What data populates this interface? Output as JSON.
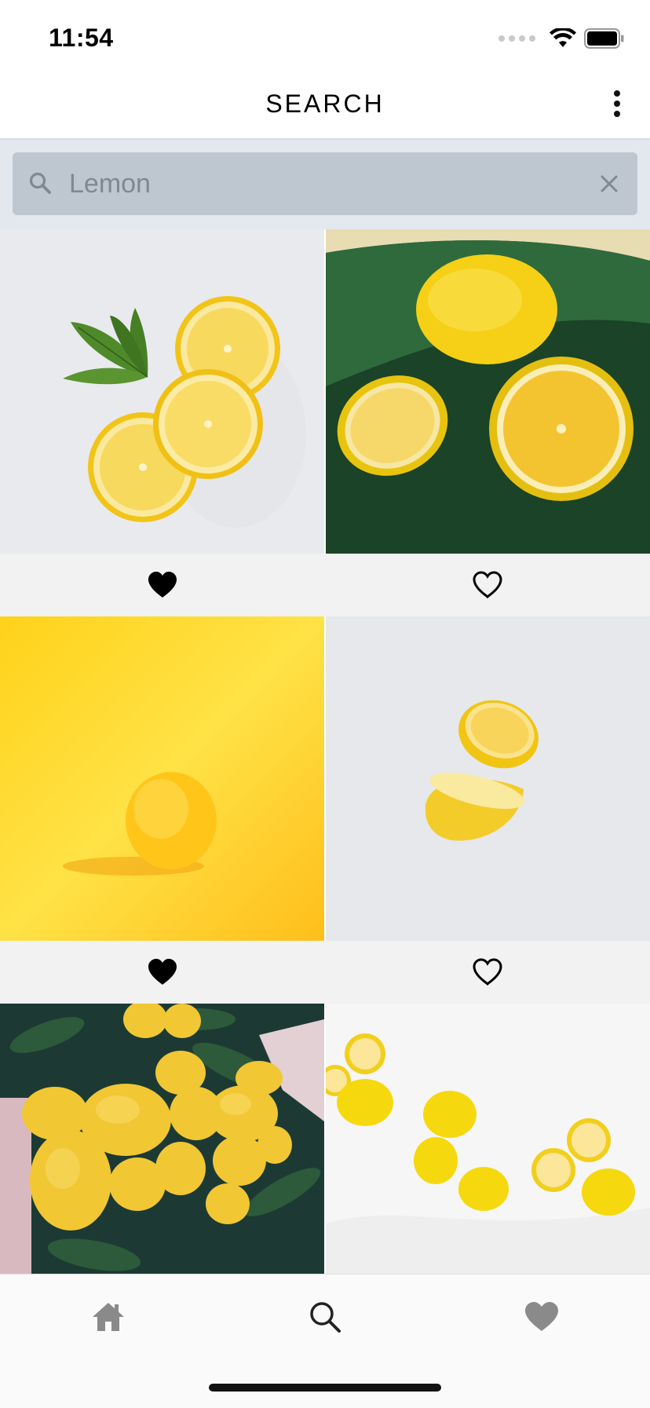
{
  "status_bar": {
    "time": "11:54",
    "icons": [
      "cellular-signal-icon",
      "wifi-icon",
      "battery-icon"
    ]
  },
  "header": {
    "title": "SEARCH",
    "menu_icon": "more-vertical-icon"
  },
  "search": {
    "value": "Lemon",
    "search_icon": "search-icon",
    "clear_icon": "close-icon"
  },
  "results": [
    {
      "image": "lemon-slices-with-leaves-photo",
      "liked": true
    },
    {
      "image": "cut-lemons-on-green-leaf-photo",
      "liked": false
    },
    {
      "image": "single-lemon-on-yellow-photo",
      "liked": true
    },
    {
      "image": "floating-lemon-halves-photo",
      "liked": false
    },
    {
      "image": "lemon-tree-photo",
      "liked": null
    },
    {
      "image": "lemons-on-white-cloth-photo",
      "liked": null
    }
  ],
  "tab_bar": {
    "tabs": [
      {
        "icon": "home-icon",
        "active": false
      },
      {
        "icon": "search-icon",
        "active": true
      },
      {
        "icon": "heart-icon",
        "active": false
      }
    ]
  },
  "colors": {
    "search_bg": "#e3e8ee",
    "search_field": "#bec6cf",
    "placeholder_text": "#7f8893",
    "like_row_bg": "#f2f2f2",
    "tab_icon_inactive": "#8a8a8a",
    "tab_icon_active": "#222222"
  }
}
